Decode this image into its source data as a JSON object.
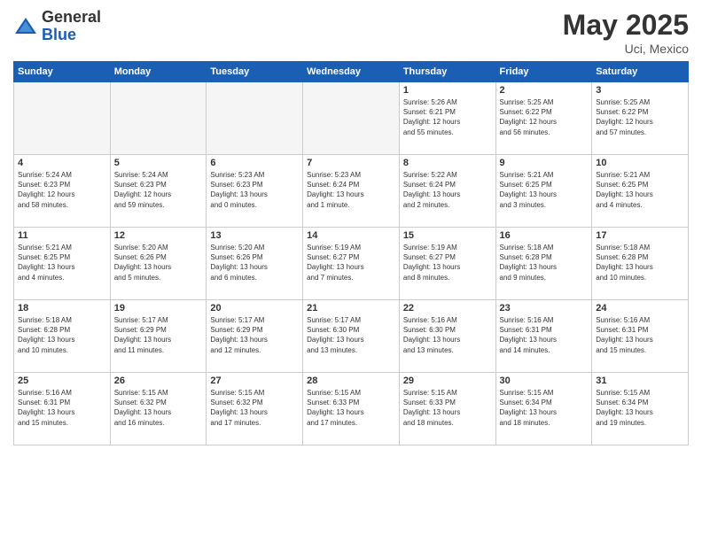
{
  "logo": {
    "general": "General",
    "blue": "Blue"
  },
  "title": "May 2025",
  "location": "Uci, Mexico",
  "days_of_week": [
    "Sunday",
    "Monday",
    "Tuesday",
    "Wednesday",
    "Thursday",
    "Friday",
    "Saturday"
  ],
  "weeks": [
    [
      {
        "day": "",
        "info": ""
      },
      {
        "day": "",
        "info": ""
      },
      {
        "day": "",
        "info": ""
      },
      {
        "day": "",
        "info": ""
      },
      {
        "day": "1",
        "info": "Sunrise: 5:26 AM\nSunset: 6:21 PM\nDaylight: 12 hours\nand 55 minutes."
      },
      {
        "day": "2",
        "info": "Sunrise: 5:25 AM\nSunset: 6:22 PM\nDaylight: 12 hours\nand 56 minutes."
      },
      {
        "day": "3",
        "info": "Sunrise: 5:25 AM\nSunset: 6:22 PM\nDaylight: 12 hours\nand 57 minutes."
      }
    ],
    [
      {
        "day": "4",
        "info": "Sunrise: 5:24 AM\nSunset: 6:23 PM\nDaylight: 12 hours\nand 58 minutes."
      },
      {
        "day": "5",
        "info": "Sunrise: 5:24 AM\nSunset: 6:23 PM\nDaylight: 12 hours\nand 59 minutes."
      },
      {
        "day": "6",
        "info": "Sunrise: 5:23 AM\nSunset: 6:23 PM\nDaylight: 13 hours\nand 0 minutes."
      },
      {
        "day": "7",
        "info": "Sunrise: 5:23 AM\nSunset: 6:24 PM\nDaylight: 13 hours\nand 1 minute."
      },
      {
        "day": "8",
        "info": "Sunrise: 5:22 AM\nSunset: 6:24 PM\nDaylight: 13 hours\nand 2 minutes."
      },
      {
        "day": "9",
        "info": "Sunrise: 5:21 AM\nSunset: 6:25 PM\nDaylight: 13 hours\nand 3 minutes."
      },
      {
        "day": "10",
        "info": "Sunrise: 5:21 AM\nSunset: 6:25 PM\nDaylight: 13 hours\nand 4 minutes."
      }
    ],
    [
      {
        "day": "11",
        "info": "Sunrise: 5:21 AM\nSunset: 6:25 PM\nDaylight: 13 hours\nand 4 minutes."
      },
      {
        "day": "12",
        "info": "Sunrise: 5:20 AM\nSunset: 6:26 PM\nDaylight: 13 hours\nand 5 minutes."
      },
      {
        "day": "13",
        "info": "Sunrise: 5:20 AM\nSunset: 6:26 PM\nDaylight: 13 hours\nand 6 minutes."
      },
      {
        "day": "14",
        "info": "Sunrise: 5:19 AM\nSunset: 6:27 PM\nDaylight: 13 hours\nand 7 minutes."
      },
      {
        "day": "15",
        "info": "Sunrise: 5:19 AM\nSunset: 6:27 PM\nDaylight: 13 hours\nand 8 minutes."
      },
      {
        "day": "16",
        "info": "Sunrise: 5:18 AM\nSunset: 6:28 PM\nDaylight: 13 hours\nand 9 minutes."
      },
      {
        "day": "17",
        "info": "Sunrise: 5:18 AM\nSunset: 6:28 PM\nDaylight: 13 hours\nand 10 minutes."
      }
    ],
    [
      {
        "day": "18",
        "info": "Sunrise: 5:18 AM\nSunset: 6:28 PM\nDaylight: 13 hours\nand 10 minutes."
      },
      {
        "day": "19",
        "info": "Sunrise: 5:17 AM\nSunset: 6:29 PM\nDaylight: 13 hours\nand 11 minutes."
      },
      {
        "day": "20",
        "info": "Sunrise: 5:17 AM\nSunset: 6:29 PM\nDaylight: 13 hours\nand 12 minutes."
      },
      {
        "day": "21",
        "info": "Sunrise: 5:17 AM\nSunset: 6:30 PM\nDaylight: 13 hours\nand 13 minutes."
      },
      {
        "day": "22",
        "info": "Sunrise: 5:16 AM\nSunset: 6:30 PM\nDaylight: 13 hours\nand 13 minutes."
      },
      {
        "day": "23",
        "info": "Sunrise: 5:16 AM\nSunset: 6:31 PM\nDaylight: 13 hours\nand 14 minutes."
      },
      {
        "day": "24",
        "info": "Sunrise: 5:16 AM\nSunset: 6:31 PM\nDaylight: 13 hours\nand 15 minutes."
      }
    ],
    [
      {
        "day": "25",
        "info": "Sunrise: 5:16 AM\nSunset: 6:31 PM\nDaylight: 13 hours\nand 15 minutes."
      },
      {
        "day": "26",
        "info": "Sunrise: 5:15 AM\nSunset: 6:32 PM\nDaylight: 13 hours\nand 16 minutes."
      },
      {
        "day": "27",
        "info": "Sunrise: 5:15 AM\nSunset: 6:32 PM\nDaylight: 13 hours\nand 17 minutes."
      },
      {
        "day": "28",
        "info": "Sunrise: 5:15 AM\nSunset: 6:33 PM\nDaylight: 13 hours\nand 17 minutes."
      },
      {
        "day": "29",
        "info": "Sunrise: 5:15 AM\nSunset: 6:33 PM\nDaylight: 13 hours\nand 18 minutes."
      },
      {
        "day": "30",
        "info": "Sunrise: 5:15 AM\nSunset: 6:34 PM\nDaylight: 13 hours\nand 18 minutes."
      },
      {
        "day": "31",
        "info": "Sunrise: 5:15 AM\nSunset: 6:34 PM\nDaylight: 13 hours\nand 19 minutes."
      }
    ]
  ]
}
